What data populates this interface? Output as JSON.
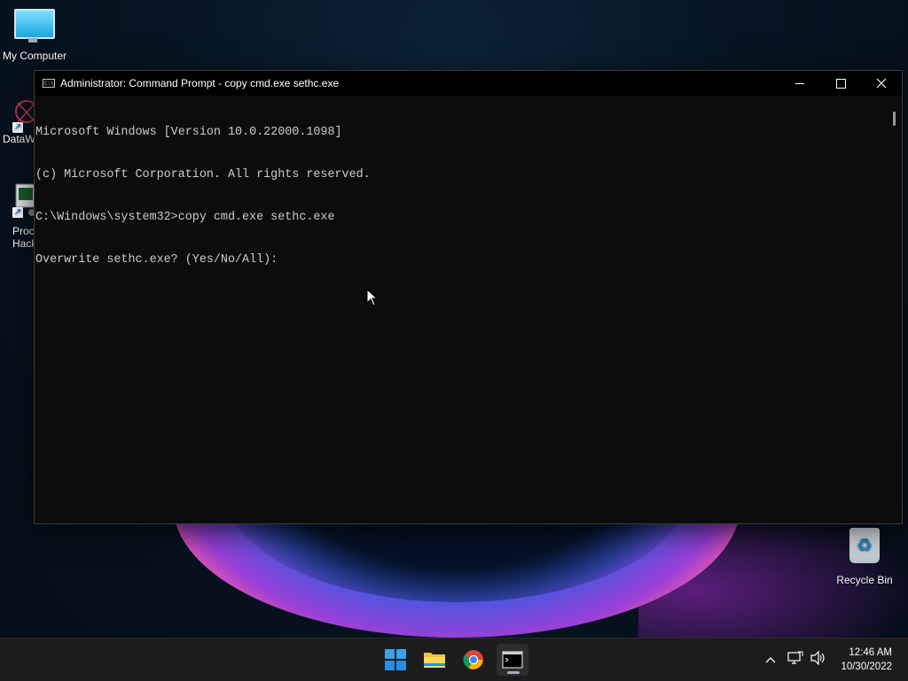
{
  "desktop": {
    "icons": [
      {
        "label": "My Computer"
      },
      {
        "label": "DataW"
      },
      {
        "label": "Proc\nHack"
      },
      {
        "label": "Recycle Bin"
      }
    ]
  },
  "window": {
    "title": "Administrator: Command Prompt - copy  cmd.exe sethc.exe",
    "controls": {
      "minimize": "—",
      "maximize": "☐",
      "close": "✕"
    },
    "console_lines": [
      "Microsoft Windows [Version 10.0.22000.1098]",
      "(c) Microsoft Corporation. All rights reserved.",
      "C:\\Windows\\system32>copy cmd.exe sethc.exe",
      "Overwrite sethc.exe? (Yes/No/All):"
    ]
  },
  "taskbar": {
    "apps": [
      {
        "name": "start-icon"
      },
      {
        "name": "file-explorer-icon"
      },
      {
        "name": "chrome-icon"
      },
      {
        "name": "terminal-icon",
        "active": true
      }
    ],
    "tray": {
      "chevron": "^",
      "time": "12:46 AM",
      "date": "10/30/2022"
    }
  },
  "colors": {
    "console_bg": "#0c0c0c",
    "console_fg": "#cccccc",
    "taskbar_bg": "#1c1c1c"
  }
}
